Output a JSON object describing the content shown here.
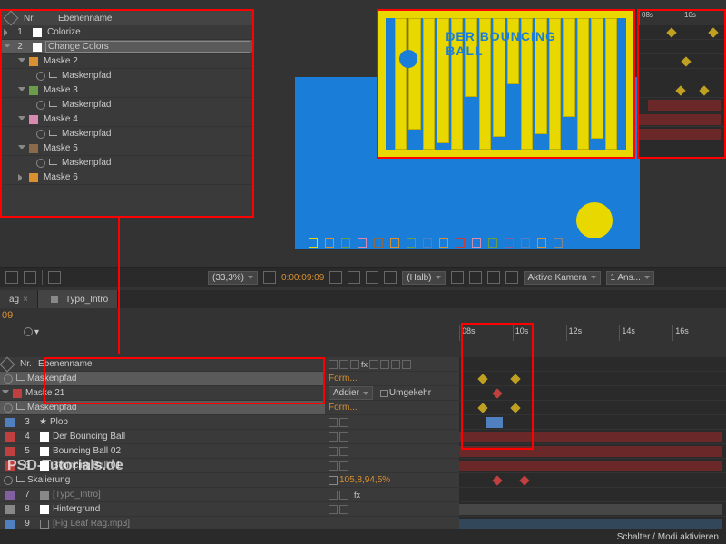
{
  "columns": {
    "nr": "Nr.",
    "name": "Ebenenname"
  },
  "top_layers": [
    {
      "nr": "1",
      "name": "Colorize"
    },
    {
      "nr": "2",
      "name": "Change Colors"
    }
  ],
  "masks": [
    {
      "name": "Maske 2",
      "path": "Maskenpfad"
    },
    {
      "name": "Maske 3",
      "path": "Maskenpfad"
    },
    {
      "name": "Maske 4",
      "path": "Maskenpfad"
    },
    {
      "name": "Maske 5",
      "path": "Maskenpfad"
    },
    {
      "name": "Maske 6"
    }
  ],
  "watermark": "PSD-Tutorials.de",
  "preview_title": "DER BOUNCING BALL",
  "toolbar": {
    "zoom": "(33,3%)",
    "timecode": "0:00:09:09",
    "res": "(Halb)",
    "camera": "Aktive Kamera",
    "views": "1 Ans..."
  },
  "tabs": {
    "t1": "ag",
    "t2": "Typo_Intro"
  },
  "time": "09",
  "timeline_ticks": {
    "t1": "08s",
    "t2": "10s",
    "t3": "12s",
    "t4": "14s",
    "t5": "16s"
  },
  "mini_ticks": {
    "t1": "08s",
    "t2": "10s"
  },
  "bottom": {
    "mask_path1": "Maskenpfad",
    "mask21": "Maske 21",
    "mask_path2": "Maskenpfad",
    "form": "Form...",
    "add": "Addier",
    "inv": "Umgekehr",
    "layers": [
      {
        "nr": "3",
        "name": "Plop"
      },
      {
        "nr": "4",
        "name": "Der Bouncing Ball"
      },
      {
        "nr": "5",
        "name": "Bouncing Ball 02"
      },
      {
        "nr": "6",
        "name": "Bouncing Ball 01"
      }
    ],
    "scale": "Skalierung",
    "scale_val": "105,8,94,5%",
    "typo": "[Typo_Intro]",
    "hinter": "Hintergrund",
    "audio": "[Fig Leaf Rag.mp3]",
    "nr7": "7",
    "nr8": "8",
    "nr9": "9"
  },
  "footer": "Schalter / Modi aktivieren"
}
